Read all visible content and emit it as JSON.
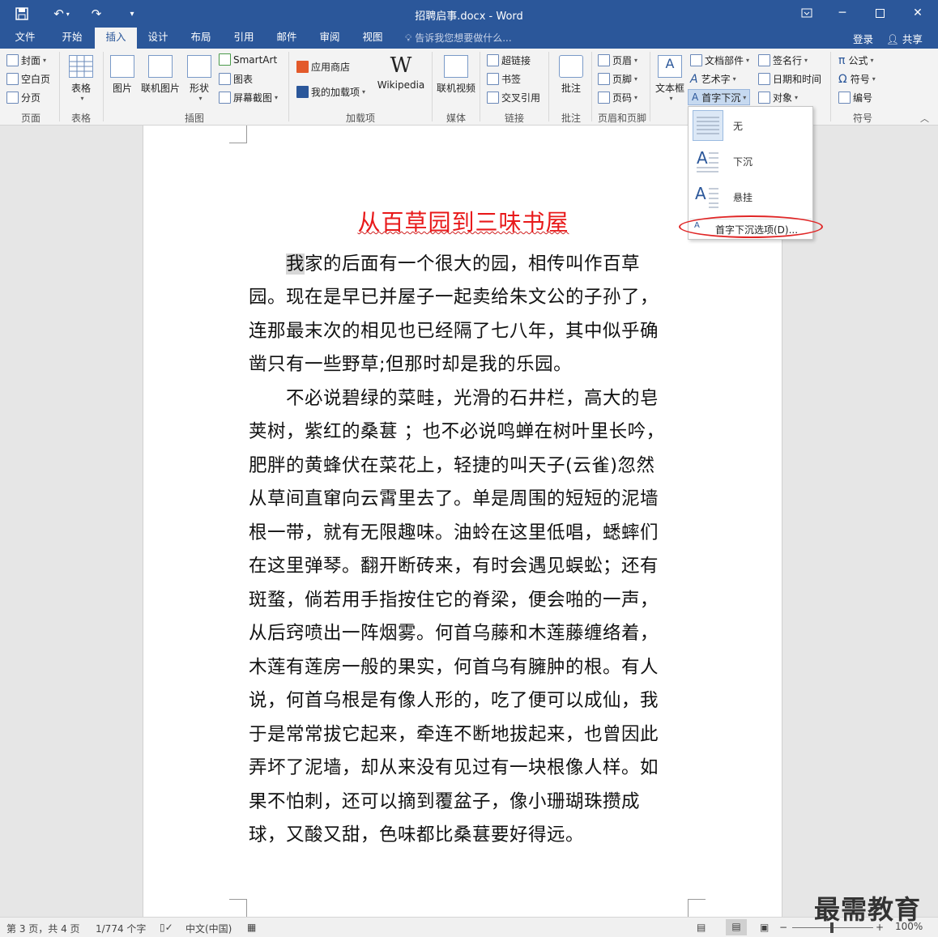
{
  "window": {
    "title": "招聘启事.docx - Word"
  },
  "tabs": [
    "文件",
    "开始",
    "插入",
    "设计",
    "布局",
    "引用",
    "邮件",
    "审阅",
    "视图"
  ],
  "tell_me": "告诉我您想要做什么...",
  "account": {
    "login": "登录",
    "share": "共享"
  },
  "ribbon": {
    "pages": {
      "cover": "封面",
      "blank": "空白页",
      "break": "分页",
      "group": "页面"
    },
    "tables": {
      "table": "表格",
      "group": "表格"
    },
    "illustrations": {
      "picture": "图片",
      "online_picture": "联机图片",
      "shapes": "形状",
      "smartart": "SmartArt",
      "chart": "图表",
      "screenshot": "屏幕截图",
      "group": "插图"
    },
    "addins": {
      "store": "应用商店",
      "my_addins": "我的加载项",
      "wikipedia": "Wikipedia",
      "group": "加载项"
    },
    "media": {
      "online_video": "联机视频",
      "group": "媒体"
    },
    "links": {
      "hyperlink": "超链接",
      "bookmark": "书签",
      "cross_ref": "交叉引用",
      "group": "链接"
    },
    "comments": {
      "comment": "批注",
      "group": "批注"
    },
    "header_footer": {
      "header": "页眉",
      "footer": "页脚",
      "page_number": "页码",
      "group": "页眉和页脚"
    },
    "text": {
      "textbox": "文本框",
      "quick_parts": "文档部件",
      "wordart": "艺术字",
      "drop_cap": "首字下沉",
      "signature": "签名行",
      "datetime": "日期和时间",
      "object": "对象"
    },
    "symbols": {
      "equation": "公式",
      "symbol": "符号",
      "number": "编号",
      "group": "符号"
    }
  },
  "dropcap_menu": {
    "items": [
      {
        "label": "无",
        "selected": true
      },
      {
        "label": "下沉",
        "selected": false
      },
      {
        "label": "悬挂",
        "selected": false
      }
    ],
    "options": "首字下沉选项(D)..."
  },
  "document": {
    "title": "从百草园到三味书屋",
    "first_char": "我",
    "lines": [
      "家的后面有一个很大的园，相传叫作百草",
      "园。现在是早已并屋子一起卖给朱文公的子孙了，",
      "连那最末次的相见也已经隔了七八年，其中似乎确",
      "凿只有一些野草;但那时却是我的乐园。",
      "不必说碧绿的菜畦，光滑的石井栏，高大的皂",
      "荚树，紫红的桑葚  ；也不必说鸣蝉在树叶里长吟，",
      "肥胖的黄蜂伏在菜花上，轻捷的叫天子(云雀)忽然",
      "从草间直窜向云霄里去了。单是周围的短短的泥墙",
      "根一带，就有无限趣味。油蛉在这里低唱，蟋蟀们",
      "在这里弹琴。翻开断砖来，有时会遇见蜈蚣；还有",
      "斑蝥，倘若用手指按住它的脊梁，便会啪的一声，",
      "从后窍喷出一阵烟雾。何首乌藤和木莲藤缠络着，",
      "木莲有莲房一般的果实，何首乌有臃肿的根。有人",
      "说，何首乌根是有像人形的，吃了便可以成仙，我",
      "于是常常拔它起来，牵连不断地拔起来，也曾因此",
      "弄坏了泥墙，却从来没有见过有一块根像人样。如",
      "果不怕刺，还可以摘到覆盆子，像小珊瑚珠攒成",
      "球，又酸又甜，色味都比桑葚要好得远。"
    ]
  },
  "status": {
    "page": "第 3 页，共 4 页",
    "words": "1/774 个字",
    "language": "中文(中国)",
    "zoom": "100%"
  },
  "watermark": "最需教育",
  "colors": {
    "brand": "#2b579a",
    "title_red": "#e8191a",
    "ellipse": "#e02525"
  }
}
